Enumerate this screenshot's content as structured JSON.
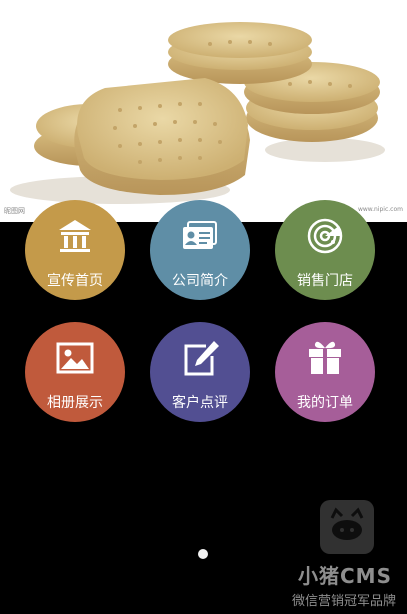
{
  "banner": {
    "caption_left": "昵图网",
    "caption_right": "www.nipic.com"
  },
  "menu": [
    {
      "label": "宣传首页",
      "icon": "bank-building-icon",
      "color": "#c49a4a"
    },
    {
      "label": "公司简介",
      "icon": "id-card-icon",
      "color": "#5f8ea6"
    },
    {
      "label": "销售门店",
      "icon": "radar-icon",
      "color": "#6d8d4f"
    },
    {
      "label": "相册展示",
      "icon": "photo-icon",
      "color": "#c05a3c"
    },
    {
      "label": "客户点评",
      "icon": "edit-icon",
      "color": "#524f92"
    },
    {
      "label": "我的订单",
      "icon": "gift-icon",
      "color": "#a65e99"
    }
  ],
  "carousel": {
    "active_page": 1
  },
  "watermark": {
    "brand": "小猪CMS",
    "slogan": "微信营销冠军品牌"
  }
}
